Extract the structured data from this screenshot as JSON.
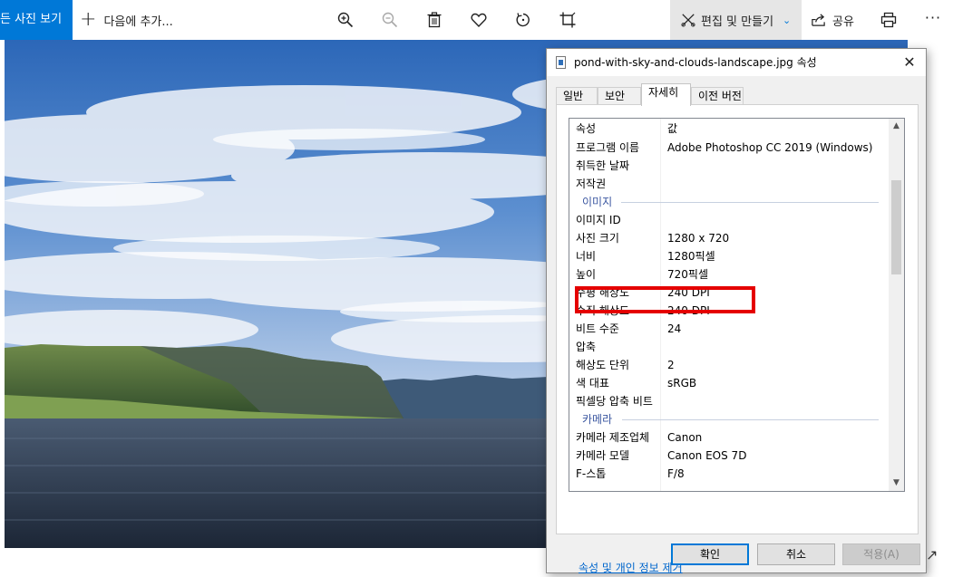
{
  "toolbar": {
    "view_all_label": "든 사진 보기",
    "add_to_label": "다음에 추가...",
    "edit_create_label": "편집 및 만들기",
    "share_label": "공유",
    "more_label": "···"
  },
  "photo": {
    "description_icon": "landscape-photo"
  },
  "dialog": {
    "title": "pond-with-sky-and-clouds-landscape.jpg 속성",
    "close_label": "✕",
    "tabs": [
      "일반",
      "보안",
      "자세히",
      "이전 버전"
    ],
    "active_tab": "자세히",
    "columns": {
      "property": "속성",
      "value": "값"
    },
    "rows": [
      {
        "k": "프로그램 이름",
        "v": "Adobe Photoshop CC 2019 (Windows)"
      },
      {
        "k": "취득한 날짜",
        "v": ""
      },
      {
        "k": "저작권",
        "v": ""
      }
    ],
    "group_image": "이미지",
    "image_rows": [
      {
        "k": "이미지 ID",
        "v": ""
      },
      {
        "k": "사진 크기",
        "v": "1280 x 720"
      },
      {
        "k": "너비",
        "v": "1280픽셀"
      },
      {
        "k": "높이",
        "v": "720픽셀"
      },
      {
        "k": "수평 해상도",
        "v": "240 DPI"
      },
      {
        "k": "수직 해상도",
        "v": "240 DPI"
      },
      {
        "k": "비트 수준",
        "v": "24"
      },
      {
        "k": "압축",
        "v": ""
      },
      {
        "k": "해상도 단위",
        "v": "2"
      },
      {
        "k": "색 대표",
        "v": "sRGB"
      },
      {
        "k": "픽셀당 압축 비트",
        "v": ""
      }
    ],
    "group_camera": "카메라",
    "camera_rows": [
      {
        "k": "카메라 제조업체",
        "v": "Canon"
      },
      {
        "k": "카메라 모델",
        "v": "Canon EOS 7D"
      },
      {
        "k": "F-스톱",
        "v": "F/8"
      }
    ],
    "remove_link": "속성 및 개인 정보 제거",
    "ok_label": "확인",
    "cancel_label": "취소",
    "apply_label": "적용(A)",
    "highlight_color": "#e50000"
  }
}
